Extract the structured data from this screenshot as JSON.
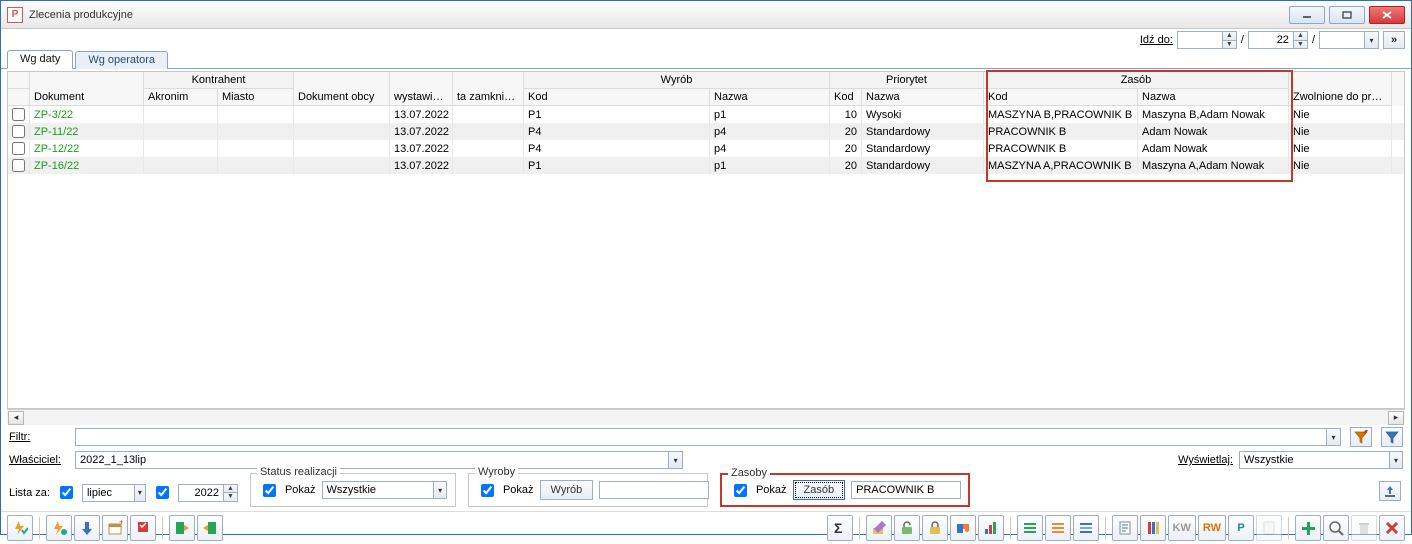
{
  "window": {
    "title": "Zlecenia produkcyjne"
  },
  "goto": {
    "label": "Idź do:",
    "v1": "",
    "v2": "22",
    "v3": ""
  },
  "tabs": [
    "Wg daty",
    "Wg operatora"
  ],
  "columns": {
    "dokument": "Dokument",
    "kontrahent": "Kontrahent",
    "akronim": "Akronim",
    "miasto": "Miasto",
    "obcy": "Dokument obcy",
    "wystawienia": "wystawienia",
    "zamkniecia": "ta zamknięcia",
    "wyrob": "Wyrób",
    "wkod": "Kod",
    "wnazwa": "Nazwa",
    "priorytet": "Priorytet",
    "pkod": "Kod",
    "pnazwa": "Nazwa",
    "zasob": "Zasób",
    "zkod": "Kod",
    "znazwa": "Nazwa",
    "zwolnione": "Zwolnione do produk"
  },
  "rows": [
    {
      "dok": "ZP-3/22",
      "wyst": "13.07.2022",
      "wkod": "P1",
      "wnaz": "p1",
      "pkod": "10",
      "pnaz": "Wysoki",
      "zkod": "MASZYNA B,PRACOWNIK B",
      "znaz": "Maszyna B,Adam Nowak",
      "zwol": "Nie"
    },
    {
      "dok": "ZP-11/22",
      "wyst": "13.07.2022",
      "wkod": "P4",
      "wnaz": "p4",
      "pkod": "20",
      "pnaz": "Standardowy",
      "zkod": "PRACOWNIK B",
      "znaz": "Adam Nowak",
      "zwol": "Nie"
    },
    {
      "dok": "ZP-12/22",
      "wyst": "13.07.2022",
      "wkod": "P4",
      "wnaz": "p4",
      "pkod": "20",
      "pnaz": "Standardowy",
      "zkod": "PRACOWNIK B",
      "znaz": "Adam Nowak",
      "zwol": "Nie"
    },
    {
      "dok": "ZP-16/22",
      "wyst": "13.07.2022",
      "wkod": "P1",
      "wnaz": "p1",
      "pkod": "20",
      "pnaz": "Standardowy",
      "zkod": "MASZYNA A,PRACOWNIK B",
      "znaz": "Maszyna A,Adam Nowak",
      "zwol": "Nie"
    }
  ],
  "filter": {
    "label": "Filtr:",
    "value": ""
  },
  "owner": {
    "label": "Właściciel:",
    "value": "2022_1_13lip"
  },
  "display": {
    "label": "Wyświetlaj:",
    "value": "Wszystkie"
  },
  "listfor": {
    "label": "Lista za:",
    "month": "lipiec",
    "year": "2022"
  },
  "status": {
    "legend": "Status realizacji",
    "pokaz": "Pokaż",
    "value": "Wszystkie"
  },
  "wyroby": {
    "legend": "Wyroby",
    "pokaz": "Pokaż",
    "btn": "Wyrób",
    "value": ""
  },
  "zasoby": {
    "legend": "Zasoby",
    "pokaz": "Pokaż",
    "btn": "Zasób",
    "value": "PRACOWNIK B"
  }
}
